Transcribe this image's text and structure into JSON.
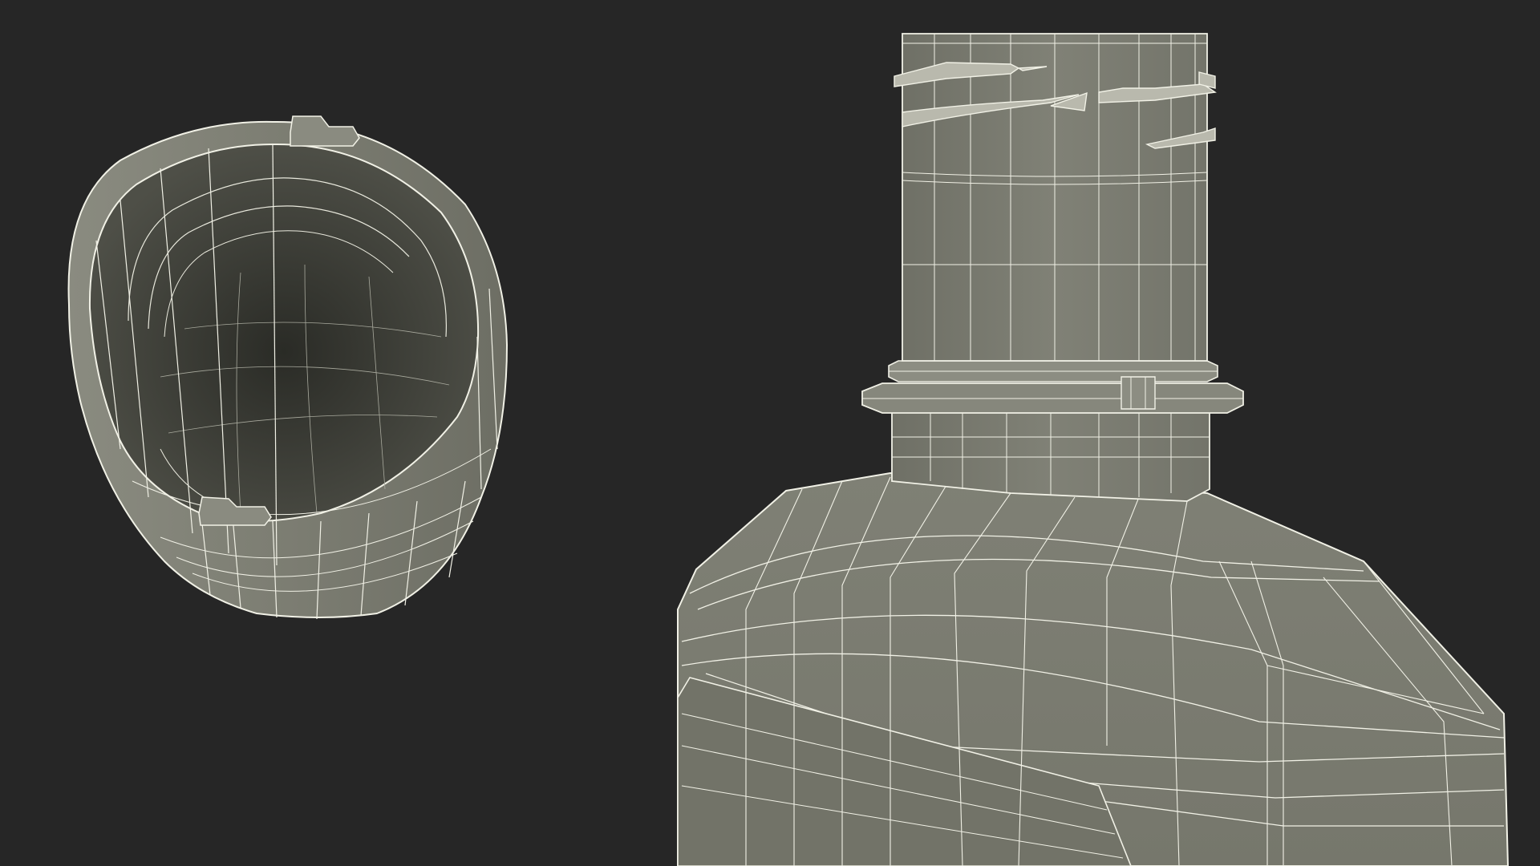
{
  "scene": {
    "background_color": "#262626",
    "mesh_fill_color": "#797a6f",
    "mesh_fill_dark": "#5e5f55",
    "mesh_interior_color": "#34352f",
    "wire_color": "#f1f1e6",
    "objects": [
      "bottle-cap",
      "bottle-neck",
      "bottle-body"
    ]
  }
}
